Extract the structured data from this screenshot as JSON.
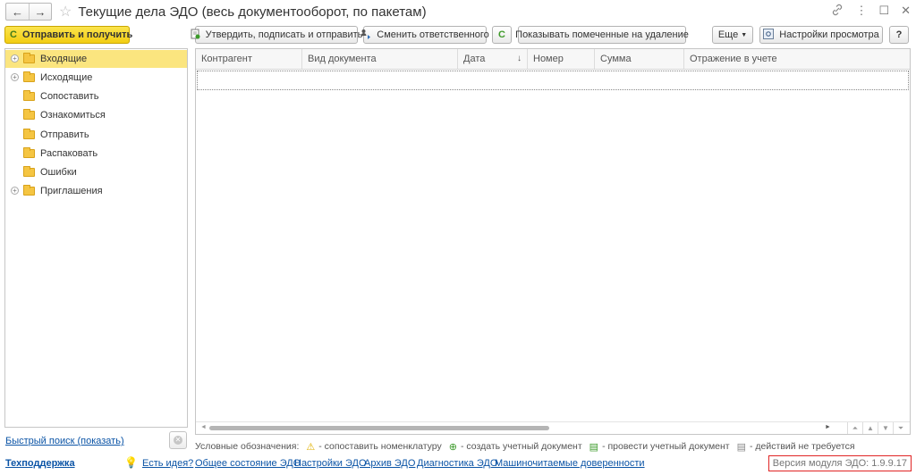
{
  "window": {
    "title": "Текущие дела ЭДО (весь документооборот, по пакетам)",
    "back_icon": "←",
    "forward_icon": "→",
    "star_icon": "☆",
    "link_icon": "🔗",
    "menu_icon": "⋮",
    "maximize_icon": "☐",
    "close_icon": "✕"
  },
  "toolbar": {
    "send_receive": "Отправить и получить",
    "approve_sign_send": "Утвердить, подписать и отправить",
    "change_responsible": "Сменить ответственного",
    "refresh_icon": "C",
    "show_deleted": "Показывать помеченные на удаление",
    "more": "Еще",
    "view_settings": "Настройки просмотра",
    "help": "?"
  },
  "tree": {
    "items": [
      {
        "label": "Входящие",
        "expandable": true,
        "selected": true
      },
      {
        "label": "Исходящие",
        "expandable": true,
        "selected": false
      },
      {
        "label": "Сопоставить",
        "expandable": false,
        "selected": false
      },
      {
        "label": "Ознакомиться",
        "expandable": false,
        "selected": false
      },
      {
        "label": "Отправить",
        "expandable": false,
        "selected": false
      },
      {
        "label": "Распаковать",
        "expandable": false,
        "selected": false
      },
      {
        "label": "Ошибки",
        "expandable": false,
        "selected": false
      },
      {
        "label": "Приглашения",
        "expandable": true,
        "selected": false
      }
    ]
  },
  "table": {
    "columns": [
      "Контрагент",
      "Вид документа",
      "Дата",
      "Номер",
      "Сумма",
      "Отражение в учете"
    ],
    "sort_indicator": "↓",
    "rows": []
  },
  "quick_search": "Быстрый поиск (показать)",
  "legend": {
    "caption": "Условные обозначения:",
    "items": [
      {
        "icon": "⚠",
        "color": "#e0b000",
        "text": "- сопоставить номенклатуру"
      },
      {
        "icon": "⊕",
        "color": "#3b9a2a",
        "text": "- создать учетный документ"
      },
      {
        "icon": "▤",
        "color": "#3b9a2a",
        "text": "- провести учетный документ"
      },
      {
        "icon": "▤",
        "color": "#888888",
        "text": "- действий не требуется"
      }
    ]
  },
  "bottom_links": {
    "support": "Техподдержка",
    "idea": "Есть идея?",
    "status": "Общее состояние ЭДО",
    "settings": "Настройки ЭДО",
    "archive": "Архив ЭДО",
    "diagnostics": "Диагностика ЭДО",
    "proxies": "Машиночитаемые доверенности"
  },
  "version": "Версия модуля ЭДО: 1.9.9.17"
}
